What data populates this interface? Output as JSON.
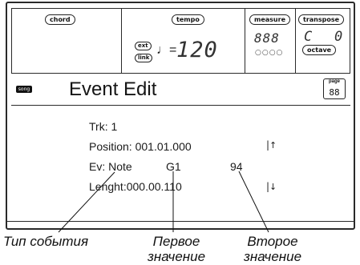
{
  "header": {
    "chord_label": "chord",
    "tempo_label": "tempo",
    "ext_label": "ext",
    "link_label": "link",
    "note_symbol": "♩=",
    "tempo_value": "120",
    "measure_label": "measure",
    "measure_value": "888",
    "measure_dots": "○○○○",
    "transpose_label": "transpose",
    "transpose_sign": "C",
    "transpose_value": "0",
    "octave_label": "octave"
  },
  "title_bar": {
    "song_badge": "song",
    "title": "Event Edit",
    "page_label": "page",
    "page_value": "88"
  },
  "fields": {
    "track": "Trk: 1",
    "position": "Position: 001.01.000",
    "event_type": "Ev: Note",
    "value1": "G1",
    "value2": "94",
    "length": "Lenght:000.00.110"
  },
  "icons": {
    "scroll_up": "scroll-up-icon",
    "scroll_down": "scroll-down-icon"
  },
  "annotations": {
    "event_type": "Тип события",
    "first_value_line1": "Первое",
    "first_value_line2": "значение",
    "second_value_line1": "Второе",
    "second_value_line2": "значение"
  }
}
